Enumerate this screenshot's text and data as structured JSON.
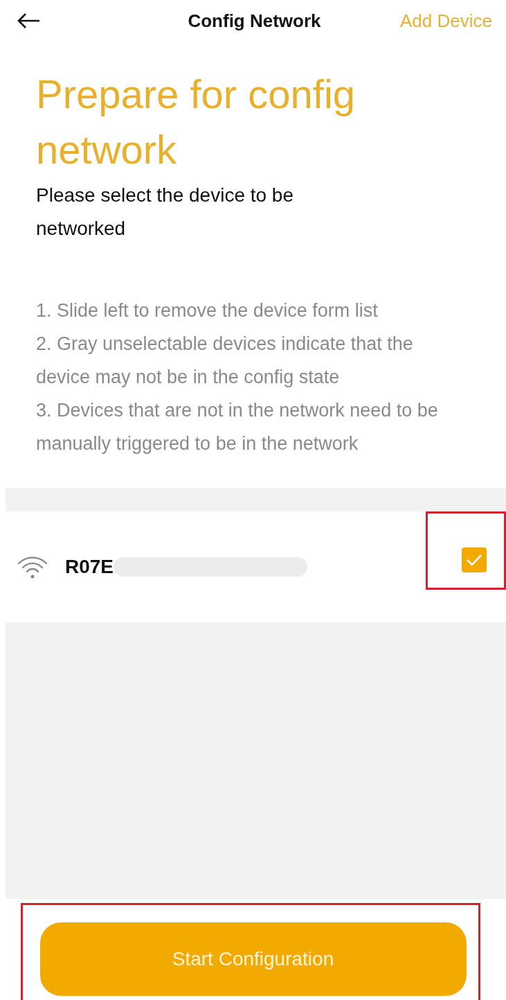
{
  "header": {
    "title": "Config Network",
    "action": "Add Device"
  },
  "heading": "Prepare for config network",
  "subtitle": "Please select the device to be networked",
  "instructions": [
    "1. Slide left to remove the device form list",
    "2. Gray unselectable devices indicate that the device may not be in the config state",
    "3. Devices that are not in the network need to be manually triggered to be in the network"
  ],
  "devices": [
    {
      "name": "R07E",
      "checked": true,
      "highlighted": true
    }
  ],
  "primary_button": {
    "label": "Start Configuration",
    "highlighted": true
  }
}
